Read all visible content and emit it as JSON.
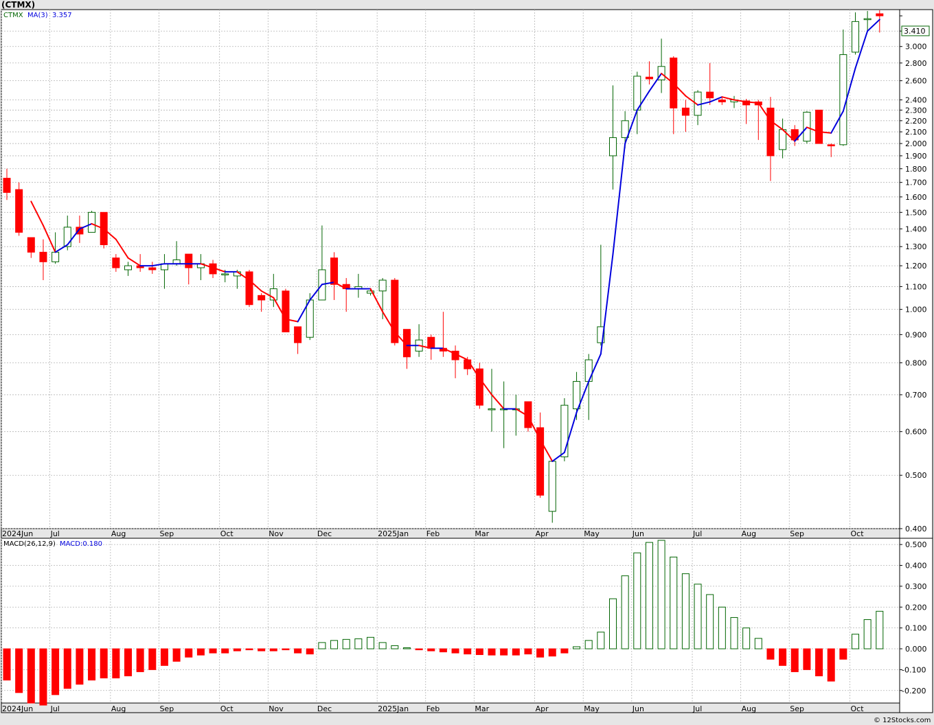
{
  "title": "(CTMX)",
  "footer": "© 12Stocks.com",
  "colors": {
    "up": "#006400",
    "down": "#ff0000",
    "ma_down": "#ff0000",
    "ma_up": "#0000dd",
    "grid": "#b4b4b4",
    "panel_bg": "#ffffff",
    "axis_bg": "#e6e6e6"
  },
  "price_panel": {
    "legend": {
      "symbol": "CTMX",
      "ma_label": "MA(3)",
      "ma_value": "3.357"
    },
    "last_price_label": "3.410",
    "y_scale": "log",
    "y_ticks": [
      "0.400",
      "0.500",
      "0.600",
      "0.700",
      "0.800",
      "0.900",
      "1.000",
      "1.100",
      "1.200",
      "1.300",
      "1.400",
      "1.500",
      "1.600",
      "1.700",
      "1.800",
      "1.900",
      "2.000",
      "2.100",
      "2.200",
      "2.300",
      "2.400",
      "2.600",
      "2.800",
      "3.000",
      "3.200",
      "3.410"
    ]
  },
  "macd_panel": {
    "legend": {
      "label": "MACD(26,12,9)",
      "value_label": "MACD:0.180"
    },
    "y_ticks": [
      "-0.200",
      "-0.100",
      "0.000",
      "0.100",
      "0.200",
      "0.300",
      "0.400",
      "0.500"
    ]
  },
  "x_axis": {
    "months": [
      {
        "label": "2024Jun",
        "week": 0
      },
      {
        "label": "Jul",
        "week": 4
      },
      {
        "label": "Aug",
        "week": 9
      },
      {
        "label": "Sep",
        "week": 13
      },
      {
        "label": "Oct",
        "week": 18
      },
      {
        "label": "Nov",
        "week": 22
      },
      {
        "label": "Dec",
        "week": 26
      },
      {
        "label": "2025Jan",
        "week": 31
      },
      {
        "label": "Feb",
        "week": 35
      },
      {
        "label": "Mar",
        "week": 39
      },
      {
        "label": "Apr",
        "week": 44
      },
      {
        "label": "May",
        "week": 48
      },
      {
        "label": "Jun",
        "week": 52
      },
      {
        "label": "Jul",
        "week": 57
      },
      {
        "label": "Aug",
        "week": 61
      },
      {
        "label": "Sep",
        "week": 65
      },
      {
        "label": "Oct",
        "week": 70
      }
    ]
  },
  "chart_data": [
    {
      "type": "candlestick",
      "title": "(CTMX)",
      "y_scale": "log",
      "ylim": [
        0.4,
        3.5
      ],
      "candles": [
        {
          "o": 1.73,
          "h": 1.8,
          "l": 1.58,
          "c": 1.63
        },
        {
          "o": 1.65,
          "h": 1.7,
          "l": 1.36,
          "c": 1.38
        },
        {
          "o": 1.35,
          "h": 1.35,
          "l": 1.24,
          "c": 1.27
        },
        {
          "o": 1.27,
          "h": 1.34,
          "l": 1.13,
          "c": 1.22
        },
        {
          "o": 1.22,
          "h": 1.38,
          "l": 1.21,
          "c": 1.27
        },
        {
          "o": 1.3,
          "h": 1.48,
          "l": 1.28,
          "c": 1.41
        },
        {
          "o": 1.41,
          "h": 1.48,
          "l": 1.32,
          "c": 1.37
        },
        {
          "o": 1.38,
          "h": 1.51,
          "l": 1.38,
          "c": 1.5
        },
        {
          "o": 1.5,
          "h": 1.5,
          "l": 1.29,
          "c": 1.31
        },
        {
          "o": 1.24,
          "h": 1.26,
          "l": 1.17,
          "c": 1.19
        },
        {
          "o": 1.18,
          "h": 1.22,
          "l": 1.15,
          "c": 1.2
        },
        {
          "o": 1.2,
          "h": 1.26,
          "l": 1.17,
          "c": 1.19
        },
        {
          "o": 1.19,
          "h": 1.22,
          "l": 1.16,
          "c": 1.18
        },
        {
          "o": 1.18,
          "h": 1.26,
          "l": 1.09,
          "c": 1.21
        },
        {
          "o": 1.21,
          "h": 1.33,
          "l": 1.2,
          "c": 1.23
        },
        {
          "o": 1.26,
          "h": 1.26,
          "l": 1.11,
          "c": 1.19
        },
        {
          "o": 1.19,
          "h": 1.26,
          "l": 1.13,
          "c": 1.21
        },
        {
          "o": 1.21,
          "h": 1.23,
          "l": 1.14,
          "c": 1.16
        },
        {
          "o": 1.16,
          "h": 1.18,
          "l": 1.12,
          "c": 1.16
        },
        {
          "o": 1.15,
          "h": 1.18,
          "l": 1.09,
          "c": 1.17
        },
        {
          "o": 1.17,
          "h": 1.18,
          "l": 1.01,
          "c": 1.02
        },
        {
          "o": 1.06,
          "h": 1.07,
          "l": 0.99,
          "c": 1.04
        },
        {
          "o": 1.04,
          "h": 1.16,
          "l": 1.01,
          "c": 1.09
        },
        {
          "o": 1.08,
          "h": 1.09,
          "l": 0.91,
          "c": 0.91
        },
        {
          "o": 0.93,
          "h": 0.93,
          "l": 0.83,
          "c": 0.87
        },
        {
          "o": 0.89,
          "h": 1.07,
          "l": 0.88,
          "c": 1.04
        },
        {
          "o": 1.04,
          "h": 1.42,
          "l": 1.04,
          "c": 1.18
        },
        {
          "o": 1.24,
          "h": 1.27,
          "l": 1.04,
          "c": 1.11
        },
        {
          "o": 1.11,
          "h": 1.14,
          "l": 0.99,
          "c": 1.09
        },
        {
          "o": 1.09,
          "h": 1.16,
          "l": 1.05,
          "c": 1.1
        },
        {
          "o": 1.07,
          "h": 1.09,
          "l": 1.06,
          "c": 1.08
        },
        {
          "o": 1.08,
          "h": 1.14,
          "l": 0.96,
          "c": 1.13
        },
        {
          "o": 1.13,
          "h": 1.14,
          "l": 0.86,
          "c": 0.87
        },
        {
          "o": 0.92,
          "h": 0.92,
          "l": 0.78,
          "c": 0.82
        },
        {
          "o": 0.84,
          "h": 0.94,
          "l": 0.82,
          "c": 0.88
        },
        {
          "o": 0.89,
          "h": 0.9,
          "l": 0.81,
          "c": 0.85
        },
        {
          "o": 0.85,
          "h": 0.99,
          "l": 0.82,
          "c": 0.84
        },
        {
          "o": 0.84,
          "h": 0.86,
          "l": 0.75,
          "c": 0.81
        },
        {
          "o": 0.81,
          "h": 0.82,
          "l": 0.76,
          "c": 0.78
        },
        {
          "o": 0.78,
          "h": 0.8,
          "l": 0.66,
          "c": 0.67
        },
        {
          "o": 0.66,
          "h": 0.78,
          "l": 0.6,
          "c": 0.66
        },
        {
          "o": 0.66,
          "h": 0.74,
          "l": 0.56,
          "c": 0.66
        },
        {
          "o": 0.66,
          "h": 0.7,
          "l": 0.59,
          "c": 0.66
        },
        {
          "o": 0.68,
          "h": 0.68,
          "l": 0.6,
          "c": 0.61
        },
        {
          "o": 0.61,
          "h": 0.65,
          "l": 0.455,
          "c": 0.46
        },
        {
          "o": 0.43,
          "h": 0.53,
          "l": 0.41,
          "c": 0.53
        },
        {
          "o": 0.54,
          "h": 0.69,
          "l": 0.53,
          "c": 0.67
        },
        {
          "o": 0.66,
          "h": 0.77,
          "l": 0.63,
          "c": 0.74
        },
        {
          "o": 0.74,
          "h": 0.83,
          "l": 0.63,
          "c": 0.81
        },
        {
          "o": 0.87,
          "h": 1.31,
          "l": 0.86,
          "c": 0.93
        },
        {
          "o": 1.9,
          "h": 2.55,
          "l": 1.65,
          "c": 2.05
        },
        {
          "o": 2.05,
          "h": 2.29,
          "l": 1.96,
          "c": 2.2
        },
        {
          "o": 2.3,
          "h": 2.7,
          "l": 2.08,
          "c": 2.65
        },
        {
          "o": 2.64,
          "h": 2.82,
          "l": 2.56,
          "c": 2.62
        },
        {
          "o": 2.61,
          "h": 3.1,
          "l": 2.47,
          "c": 2.76
        },
        {
          "o": 2.86,
          "h": 2.88,
          "l": 2.08,
          "c": 2.32
        },
        {
          "o": 2.32,
          "h": 2.4,
          "l": 2.1,
          "c": 2.25
        },
        {
          "o": 2.25,
          "h": 2.5,
          "l": 2.16,
          "c": 2.48
        },
        {
          "o": 2.48,
          "h": 2.8,
          "l": 2.35,
          "c": 2.42
        },
        {
          "o": 2.4,
          "h": 2.43,
          "l": 2.35,
          "c": 2.38
        },
        {
          "o": 2.38,
          "h": 2.44,
          "l": 2.32,
          "c": 2.4
        },
        {
          "o": 2.39,
          "h": 2.41,
          "l": 2.17,
          "c": 2.35
        },
        {
          "o": 2.38,
          "h": 2.4,
          "l": 2.03,
          "c": 2.35
        },
        {
          "o": 2.32,
          "h": 2.43,
          "l": 1.71,
          "c": 1.9
        },
        {
          "o": 1.95,
          "h": 2.22,
          "l": 1.88,
          "c": 2.12
        },
        {
          "o": 2.12,
          "h": 2.16,
          "l": 1.98,
          "c": 2.03
        },
        {
          "o": 2.02,
          "h": 2.29,
          "l": 2.0,
          "c": 2.28
        },
        {
          "o": 2.3,
          "h": 2.3,
          "l": 2.0,
          "c": 2.0
        },
        {
          "o": 1.99,
          "h": 2.0,
          "l": 1.89,
          "c": 1.98
        },
        {
          "o": 1.99,
          "h": 3.22,
          "l": 1.98,
          "c": 2.9
        },
        {
          "o": 2.93,
          "h": 3.46,
          "l": 2.9,
          "c": 3.33
        },
        {
          "o": 3.36,
          "h": 3.48,
          "l": 3.2,
          "c": 3.37
        },
        {
          "o": 3.44,
          "h": 3.49,
          "l": 3.18,
          "c": 3.41
        }
      ],
      "ma": {
        "name": "MA(3)",
        "values": [
          null,
          null,
          1.57,
          1.42,
          1.27,
          1.31,
          1.4,
          1.43,
          1.4,
          1.34,
          1.24,
          1.2,
          1.2,
          1.21,
          1.21,
          1.21,
          1.21,
          1.19,
          1.17,
          1.17,
          1.13,
          1.08,
          1.05,
          0.96,
          0.95,
          1.04,
          1.11,
          1.12,
          1.09,
          1.09,
          1.09,
          0.99,
          0.91,
          0.86,
          0.86,
          0.85,
          0.85,
          0.83,
          0.81,
          0.75,
          0.7,
          0.66,
          0.66,
          0.64,
          0.58,
          0.53,
          0.55,
          0.65,
          0.74,
          0.83,
          1.26,
          2.0,
          2.3,
          2.49,
          2.68,
          2.57,
          2.44,
          2.35,
          2.38,
          2.43,
          2.4,
          2.38,
          2.37,
          2.2,
          2.12,
          2.02,
          2.14,
          2.1,
          2.09,
          2.29,
          2.74,
          3.2,
          3.357
        ]
      }
    },
    {
      "type": "bar",
      "title": "MACD(26,12,9)",
      "ylim": [
        -0.26,
        0.53
      ],
      "values": [
        -0.15,
        -0.21,
        -0.26,
        -0.27,
        -0.22,
        -0.19,
        -0.17,
        -0.15,
        -0.14,
        -0.14,
        -0.13,
        -0.11,
        -0.1,
        -0.08,
        -0.06,
        -0.04,
        -0.03,
        -0.02,
        -0.02,
        -0.01,
        -0.005,
        -0.01,
        -0.01,
        -0.005,
        -0.02,
        -0.025,
        0.03,
        0.04,
        0.045,
        0.048,
        0.055,
        0.03,
        0.015,
        0.005,
        -0.005,
        -0.01,
        -0.015,
        -0.02,
        -0.025,
        -0.028,
        -0.03,
        -0.03,
        -0.03,
        -0.025,
        -0.04,
        -0.035,
        -0.02,
        0.01,
        0.04,
        0.08,
        0.24,
        0.35,
        0.46,
        0.51,
        0.52,
        0.44,
        0.36,
        0.31,
        0.26,
        0.2,
        0.15,
        0.1,
        0.05,
        -0.05,
        -0.08,
        -0.11,
        -0.1,
        -0.13,
        -0.155,
        -0.05,
        0.07,
        0.14,
        0.18
      ]
    }
  ]
}
